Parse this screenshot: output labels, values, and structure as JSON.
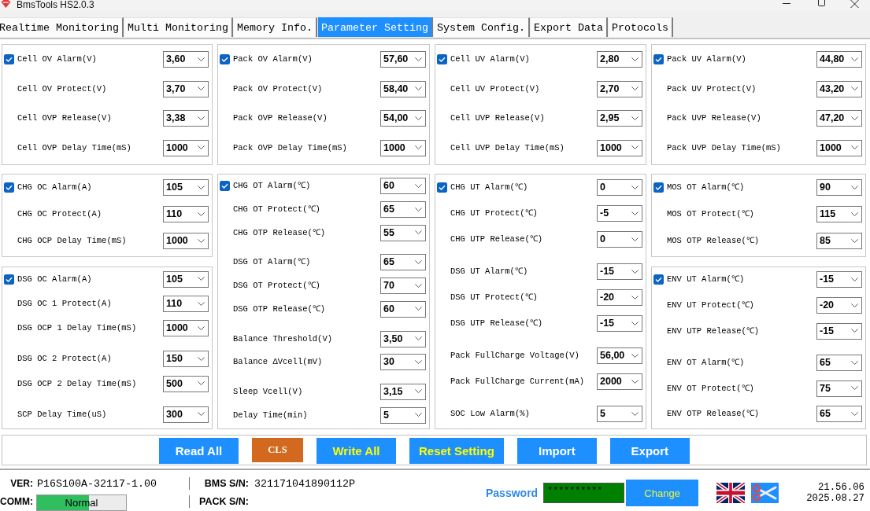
{
  "window": {
    "title": "BmsTools HS2.0.3"
  },
  "tabs": [
    {
      "label": "Realtime Monitoring",
      "selected": false
    },
    {
      "label": "Multi Monitoring",
      "selected": false
    },
    {
      "label": "Memory Info.",
      "selected": false
    },
    {
      "label": "Parameter Setting",
      "selected": true
    },
    {
      "label": "System Config.",
      "selected": false
    },
    {
      "label": "Export Data",
      "selected": false
    },
    {
      "label": "Protocols",
      "selected": false
    }
  ],
  "parameter_columns": [
    {
      "panels": [
        {
          "groups": [
            {
              "rows": [
                {
                  "kind": "checkbox",
                  "checked": true,
                  "label": "Cell OV Alarm(V)",
                  "value": "3,60"
                },
                {
                  "kind": "plain",
                  "label": "Cell OV Protect(V)",
                  "value": "3,70"
                },
                {
                  "kind": "plain",
                  "label": "Cell OVP Release(V)",
                  "value": "3,38"
                },
                {
                  "kind": "plain",
                  "label": "Cell OVP Delay Time(mS)",
                  "value": "1000"
                }
              ]
            }
          ]
        },
        {
          "groups": [
            {
              "rows": [
                {
                  "kind": "checkbox",
                  "checked": true,
                  "label": "CHG OC Alarm(A)",
                  "value": "105"
                },
                {
                  "kind": "plain",
                  "label": "CHG OC Protect(A)",
                  "value": "110"
                },
                {
                  "kind": "plain",
                  "label": "CHG OCP Delay Time(mS)",
                  "value": "1000"
                }
              ]
            }
          ]
        },
        {
          "groups": [
            {
              "rows": [
                {
                  "kind": "checkbox",
                  "checked": true,
                  "label": "DSG OC Alarm(A)",
                  "value": "105"
                },
                {
                  "kind": "plain",
                  "label": "DSG OC 1 Protect(A)",
                  "value": "110"
                },
                {
                  "kind": "plain",
                  "label": "DSG OCP 1 Delay Time(mS)",
                  "value": "1000"
                }
              ]
            },
            {
              "rows": [
                {
                  "kind": "plain",
                  "label": "DSG OC 2 Protect(A)",
                  "value": "150"
                },
                {
                  "kind": "plain",
                  "label": "DSG OCP 2 Delay Time(mS)",
                  "value": "500"
                }
              ]
            },
            {
              "rows": [
                {
                  "kind": "plain",
                  "label": "SCP Delay Time(uS)",
                  "value": "300"
                }
              ]
            }
          ]
        }
      ]
    },
    {
      "panels": [
        {
          "groups": [
            {
              "rows": [
                {
                  "kind": "checkbox",
                  "checked": true,
                  "label": "Pack OV Alarm(V)",
                  "value": "57,60"
                },
                {
                  "kind": "plain",
                  "label": "Pack OV Protect(V)",
                  "value": "58,40"
                },
                {
                  "kind": "plain",
                  "label": "Pack OVP Release(V)",
                  "value": "54,00"
                },
                {
                  "kind": "plain",
                  "label": "Pack OVP Delay Time(mS)",
                  "value": "1000"
                }
              ]
            }
          ]
        },
        {
          "groups": [
            {
              "rows": [
                {
                  "kind": "checkbox",
                  "checked": true,
                  "label": "CHG OT Alarm(℃)",
                  "value": "60"
                },
                {
                  "kind": "plain",
                  "label": "CHG OT Protect(℃)",
                  "value": "65"
                },
                {
                  "kind": "plain",
                  "label": "CHG OTP Release(℃)",
                  "value": "55"
                }
              ]
            },
            {
              "rows": [
                {
                  "kind": "plain",
                  "label": "DSG OT Alarm(℃)",
                  "value": "65"
                },
                {
                  "kind": "plain",
                  "label": "DSG OT Protect(℃)",
                  "value": "70"
                },
                {
                  "kind": "plain",
                  "label": "DSG OTP Release(℃)",
                  "value": "60"
                }
              ]
            },
            {
              "rows": [
                {
                  "kind": "plain",
                  "label": "Balance Threshold(V)",
                  "value": "3,50"
                },
                {
                  "kind": "plain",
                  "label": "Balance ΔVcell(mV)",
                  "value": "30"
                }
              ]
            },
            {
              "rows": [
                {
                  "kind": "plain",
                  "label": "Sleep Vcell(V)",
                  "value": "3,15"
                },
                {
                  "kind": "plain",
                  "label": "Delay Time(min)",
                  "value": "5"
                }
              ]
            }
          ]
        }
      ]
    },
    {
      "panels": [
        {
          "groups": [
            {
              "rows": [
                {
                  "kind": "checkbox",
                  "checked": true,
                  "label": "Cell UV Alarm(V)",
                  "value": "2,80"
                },
                {
                  "kind": "plain",
                  "label": "Cell UV Protect(V)",
                  "value": "2,70"
                },
                {
                  "kind": "plain",
                  "label": "Cell UVP Release(V)",
                  "value": "2,95"
                },
                {
                  "kind": "plain",
                  "label": "Cell UVP Delay Time(mS)",
                  "value": "1000"
                }
              ]
            }
          ]
        },
        {
          "groups": [
            {
              "rows": [
                {
                  "kind": "checkbox",
                  "checked": true,
                  "label": "CHG UT Alarm(℃)",
                  "value": "0"
                },
                {
                  "kind": "plain",
                  "label": "CHG UT Protect(℃)",
                  "value": "-5"
                },
                {
                  "kind": "plain",
                  "label": "CHG UTP Release(℃)",
                  "value": "0"
                }
              ]
            },
            {
              "rows": [
                {
                  "kind": "plain",
                  "label": "DSG UT Alarm(℃)",
                  "value": "-15"
                },
                {
                  "kind": "plain",
                  "label": "DSG UT Protect(℃)",
                  "value": "-20"
                },
                {
                  "kind": "plain",
                  "label": "DSG UTP Release(℃)",
                  "value": "-15"
                }
              ]
            },
            {
              "rows": [
                {
                  "kind": "plain",
                  "label": "Pack FullCharge Voltage(V)",
                  "value": "56,00"
                },
                {
                  "kind": "plain",
                  "label": "Pack FullCharge Current(mA)",
                  "value": "2000"
                }
              ]
            },
            {
              "rows": [
                {
                  "kind": "plain",
                  "label": "SOC Low Alarm(%)",
                  "value": "5"
                }
              ]
            }
          ]
        }
      ]
    },
    {
      "panels": [
        {
          "groups": [
            {
              "rows": [
                {
                  "kind": "checkbox",
                  "checked": true,
                  "label": "Pack UV Alarm(V)",
                  "value": "44,80"
                },
                {
                  "kind": "plain",
                  "label": "Pack UV Protect(V)",
                  "value": "43,20"
                },
                {
                  "kind": "plain",
                  "label": "Pack UVP Release(V)",
                  "value": "47,20"
                },
                {
                  "kind": "plain",
                  "label": "Pack UVP Delay Time(mS)",
                  "value": "1000"
                }
              ]
            }
          ]
        },
        {
          "groups": [
            {
              "rows": [
                {
                  "kind": "checkbox",
                  "checked": true,
                  "label": "MOS OT Alarm(℃)",
                  "value": "90"
                },
                {
                  "kind": "plain",
                  "label": "MOS OT Protect(℃)",
                  "value": "115"
                },
                {
                  "kind": "plain",
                  "label": "MOS OTP Release(℃)",
                  "value": "85"
                }
              ]
            }
          ]
        },
        {
          "groups": [
            {
              "rows": [
                {
                  "kind": "checkbox",
                  "checked": true,
                  "label": "ENV UT Alarm(℃)",
                  "value": "-15"
                },
                {
                  "kind": "plain",
                  "label": "ENV UT Protect(℃)",
                  "value": "-20"
                },
                {
                  "kind": "plain",
                  "label": "ENV UTP Release(℃)",
                  "value": "-15"
                }
              ]
            },
            {
              "rows": [
                {
                  "kind": "plain",
                  "label": "ENV OT Alarm(℃)",
                  "value": "65"
                },
                {
                  "kind": "plain",
                  "label": "ENV OT Protect(℃)",
                  "value": "75"
                },
                {
                  "kind": "plain",
                  "label": "ENV OTP Release(℃)",
                  "value": "65"
                }
              ]
            }
          ]
        }
      ]
    }
  ],
  "action_buttons": [
    {
      "label": "Read All",
      "kind": "normal"
    },
    {
      "label": "CLS",
      "kind": "clear"
    },
    {
      "label": "Write All",
      "kind": "highlight"
    },
    {
      "label": "Reset Setting",
      "kind": "highlight"
    },
    {
      "label": "Import",
      "kind": "normal"
    },
    {
      "label": "Export",
      "kind": "normal"
    }
  ],
  "status_bar": {
    "version": {
      "label": "VER:",
      "value": "P16S100A-32117-1.00"
    },
    "comm": {
      "label": "COMM:",
      "status": "Normal",
      "level": 0.58
    },
    "bms_sn": {
      "label": "BMS S/N:",
      "value": "321171041890112P"
    },
    "pack_sn": {
      "label": "PACK S/N:"
    },
    "password": {
      "label": "Password",
      "value": "**********"
    },
    "change_button": "Change",
    "time": "21.56.06",
    "date": "2025.08.27"
  }
}
